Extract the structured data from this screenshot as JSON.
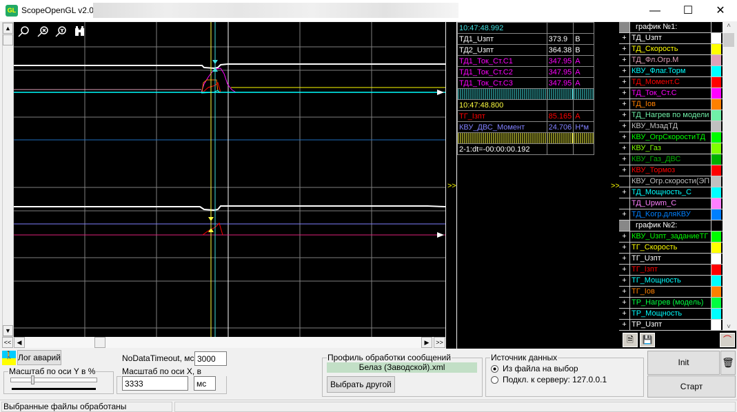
{
  "window": {
    "title": "ScopeOpenGL v2.04",
    "app_icon": "GL",
    "minimize": "—",
    "maximize": "☐",
    "close": "✕"
  },
  "plot": {
    "toolbar_icons": [
      "zoom-icon",
      "zoom-x-icon",
      "zoom-y-icon",
      "binoculars-icon"
    ],
    "expand_marker": ">>"
  },
  "values_table": {
    "rows": [
      {
        "name": "10:47:48.992",
        "value": "",
        "unit": "",
        "color": "#40e0e0"
      },
      {
        "name": "ТД1_Uзпт",
        "value": "373.9",
        "unit": "В",
        "color": "#ffffff"
      },
      {
        "name": "ТД2_Uзпт",
        "value": "364.38",
        "unit": "В",
        "color": "#ffffff"
      },
      {
        "name": "ТД1_Ток_Ст.С1",
        "value": "347.95",
        "unit": "А",
        "color": "#ff00ff"
      },
      {
        "name": "ТД1_Ток_Ст.С2",
        "value": "347.95",
        "unit": "А",
        "color": "#ff00ff"
      },
      {
        "name": "ТД1_Ток_Ст.С3",
        "value": "347.95",
        "unit": "А",
        "color": "#ff00ff"
      },
      {
        "bars": "#40e0e0"
      },
      {
        "name": "10:47:48.800",
        "value": "",
        "unit": "",
        "color": "#ffff40"
      },
      {
        "name": "ТГ_Iзпт",
        "value": "85.165",
        "unit": "А",
        "color": "#ff0000"
      },
      {
        "name": "КВУ_ДВС_Момент",
        "value": "24.706",
        "unit": "Н*м",
        "color": "#8080ff"
      },
      {
        "bars": "#ffff40"
      },
      {
        "name": "2-1:dt=-00:00:00.192",
        "value": "",
        "unit": "",
        "color": "#ffffff"
      }
    ]
  },
  "signals": [
    {
      "group": "график №1:"
    },
    {
      "plus": "+",
      "name": "ТД_Uзпт",
      "color": "#ffffff"
    },
    {
      "plus": "+",
      "name": "ТД_Скорость",
      "color": "#ffff00"
    },
    {
      "plus": "+",
      "name": "ТД_Фл.Огр.М",
      "color": "#e0a0b8"
    },
    {
      "plus": "+",
      "name": "КВУ_Флаг.Торм",
      "color": "#00ffff"
    },
    {
      "plus": "+",
      "name": "ТД_Момент.С",
      "color": "#ff0000"
    },
    {
      "plus": "+",
      "name": "ТД_Ток_Ст.С",
      "color": "#ff00ff"
    },
    {
      "plus": "+",
      "name": "ТД_Iов",
      "color": "#ff8000"
    },
    {
      "plus": "+",
      "name": "ТД_Нагрев по модели",
      "color": "#70f0a8"
    },
    {
      "plus": "+",
      "name": "КВУ_МзадТД",
      "color": "#c0c0c0"
    },
    {
      "plus": "+",
      "name": "КВУ_ОгрСкоростиТД",
      "color": "#00ff00"
    },
    {
      "plus": "+",
      "name": "КВУ_Газ",
      "color": "#80ff00"
    },
    {
      "plus": "+",
      "name": "КВУ_Газ_ДВС",
      "color": "#00b000"
    },
    {
      "plus": "+",
      "name": "КВУ_Тормоз",
      "color": "#ff0000"
    },
    {
      "plus": "",
      "name": "КВУ_Огр.скорости(ЭП",
      "color": "#c0c0c0"
    },
    {
      "plus": "+",
      "name": "ТД_Мощность_С",
      "color": "#00ffff"
    },
    {
      "plus": "",
      "name": "ТД_Upwm_С",
      "color": "#ff80ff"
    },
    {
      "plus": "+",
      "name": "ТД_Kогр.дляКВУ",
      "color": "#0080ff"
    },
    {
      "group": "график №2:"
    },
    {
      "plus": "+",
      "name": "КВУ_Uзпт_заданиеТГ",
      "color": "#00ff00"
    },
    {
      "plus": "+",
      "name": "ТГ_Скорость",
      "color": "#ffff00"
    },
    {
      "plus": "+",
      "name": "ТГ_Uзпт",
      "color": "#ffffff"
    },
    {
      "plus": "+",
      "name": "ТГ_Iзпт",
      "color": "#ff0000"
    },
    {
      "plus": "+",
      "name": "ТГ_Мощность",
      "color": "#00ffff"
    },
    {
      "plus": "+",
      "name": "ТГ_Iов",
      "color": "#ff8000"
    },
    {
      "plus": "+",
      "name": "ТР_Нагрев (модель)",
      "color": "#00ff40"
    },
    {
      "plus": "+",
      "name": "ТР_Мощность",
      "color": "#00ffff"
    },
    {
      "plus": "+",
      "name": "ТР_Uзпт",
      "color": "#ffffff"
    }
  ],
  "controls": {
    "log_button": "Лог аварий",
    "nodata_label": "NoDataTimeout, мс:",
    "nodata_value": "3000",
    "yscale_legend": "Масштаб по оси Y в %",
    "yscale_percent": 25,
    "xscale_legend": "Масштаб по оси X, в клетке:",
    "xscale_value": "3333",
    "xscale_unit": "мс",
    "profile_legend": "Профиль обработки сообщений",
    "profile_file": "Белаз (Заводской).xml",
    "profile_button": "Выбрать другой",
    "source_legend": "Источник данных",
    "source_file": "Из файла на выбор",
    "source_server": "Подкл. к серверу: 127.0.0.1",
    "init_button": "Init",
    "start_button": "Старт"
  },
  "status": {
    "text": "Выбранные файлы обработаны"
  }
}
